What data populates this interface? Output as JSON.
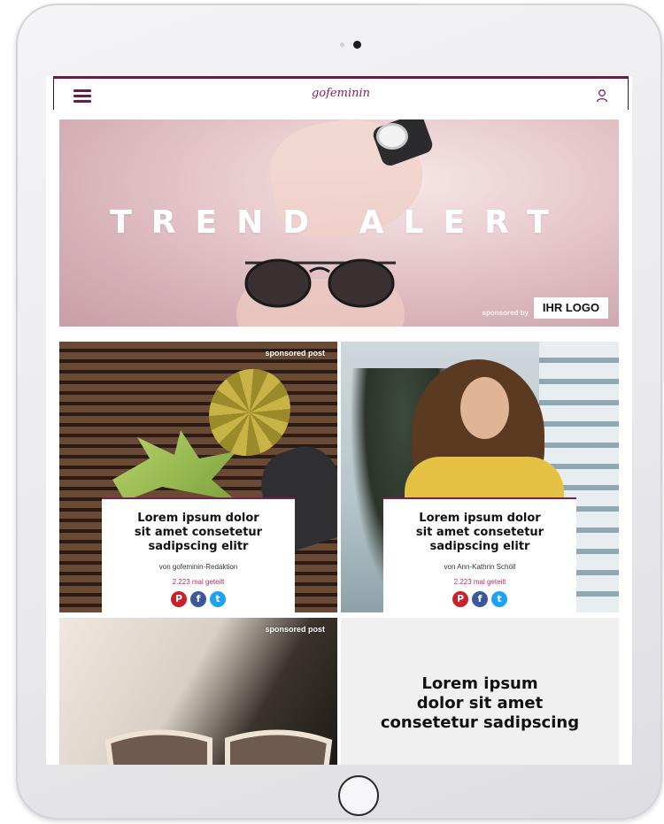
{
  "header": {
    "brand": "gofeminin",
    "menu_icon": "hamburger-menu-icon",
    "account_icon": "user-icon"
  },
  "hero": {
    "title": "TREND ALERT",
    "sponsored_by": "sponsored by",
    "logo_label": "IHR LOGO"
  },
  "tiles": [
    {
      "badge": "sponsored post",
      "title": "Lorem ipsum dolor sit amet consetetur sadipscing elitr",
      "author": "von gofeminin-Redaktion",
      "shares": "2.223 mal geteilt"
    },
    {
      "badge": "",
      "title": "Lorem ipsum dolor sit amet consetetur sadipscing elitr",
      "author": "von Ann-Kathrin Schöll",
      "shares": "2.223 mal geteilt"
    },
    {
      "badge": "sponsored post"
    },
    {
      "promo": "Lorem ipsum dolor sit amet consetetur sadipscing"
    }
  ],
  "social": {
    "pinterest": "P",
    "facebook": "f",
    "twitter": "t"
  },
  "colors": {
    "brand": "#8b1f5a",
    "accent": "#6a1a4c",
    "pinterest": "#cb2027",
    "facebook": "#3b5998",
    "twitter": "#1da1f2"
  }
}
